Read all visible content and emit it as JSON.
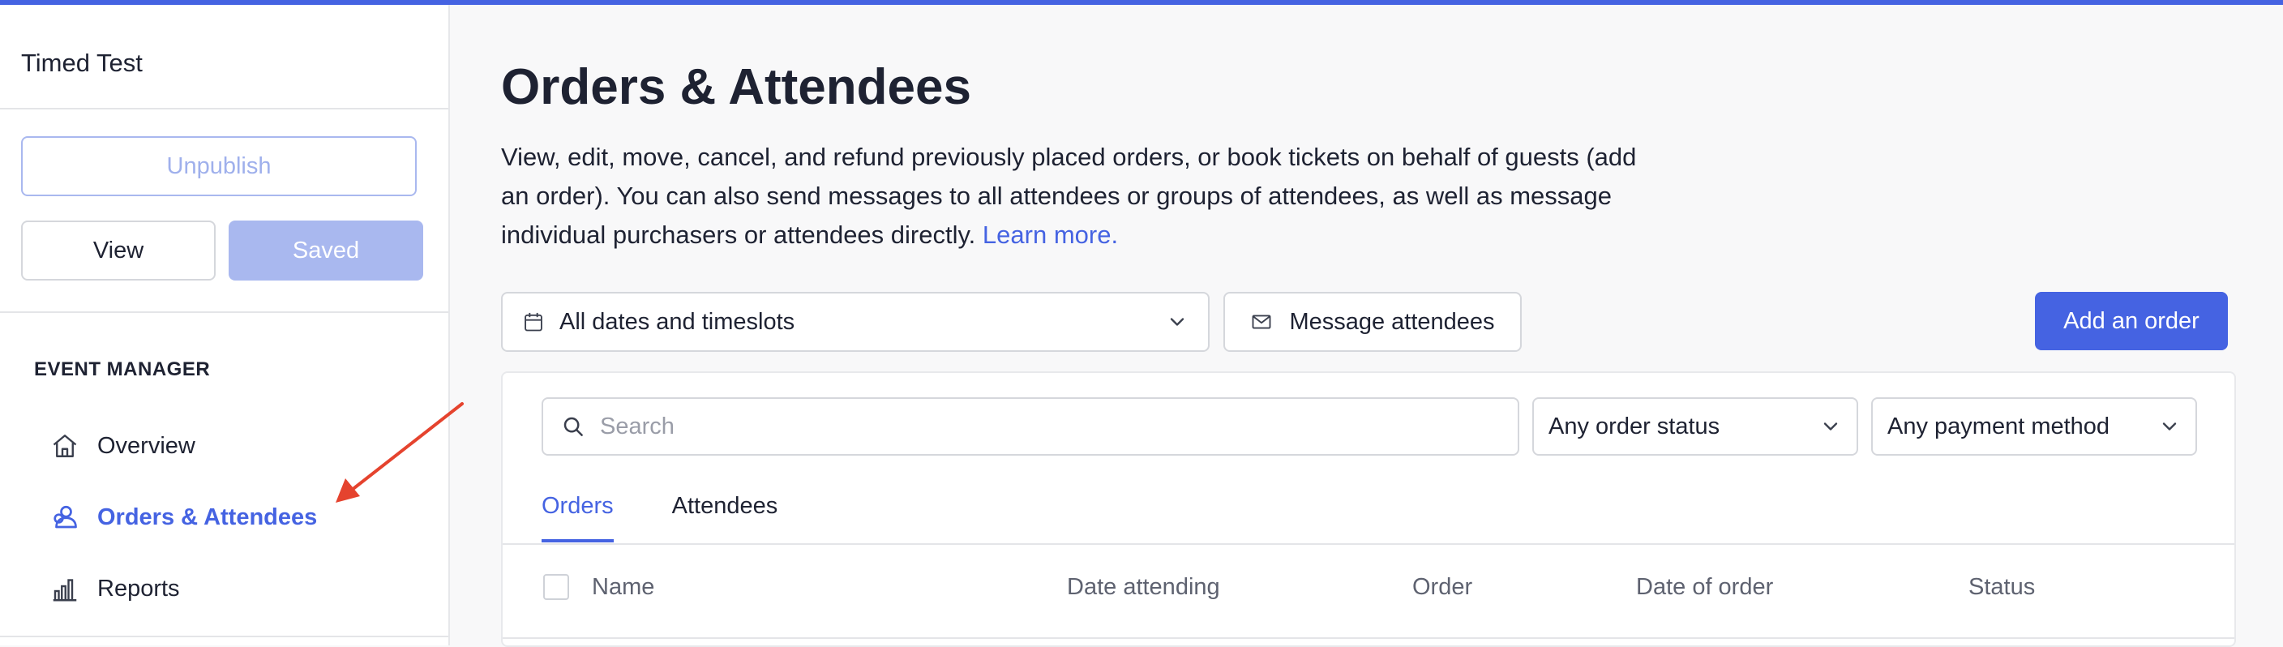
{
  "colors": {
    "accent": "#4563e2",
    "accent_light": "#a9b8ef",
    "arrow": "#e5432e",
    "text": "#1e2232",
    "muted": "#5e6270"
  },
  "sidebar": {
    "event_title": "Timed Test",
    "unpublish_label": "Unpublish",
    "view_label": "View",
    "saved_label": "Saved",
    "section_label": "EVENT MANAGER",
    "items": [
      {
        "label": "Overview",
        "icon": "home-icon"
      },
      {
        "label": "Orders & Attendees",
        "icon": "attendees-icon",
        "active": true
      },
      {
        "label": "Reports",
        "icon": "bar-chart-icon"
      }
    ]
  },
  "main": {
    "title": "Orders & Attendees",
    "description": "View, edit, move, cancel, and refund previously placed orders, or book tickets on behalf of guests (add an order). You can also send messages to all attendees or groups of attendees, as well as message individual purchasers or attendees directly.",
    "learn_more": "Learn more.",
    "date_filter": "All dates and timeslots",
    "message_label": "Message attendees",
    "add_order_label": "Add an order",
    "search_placeholder": "Search",
    "order_status_filter": "Any order status",
    "payment_method_filter": "Any payment method",
    "tabs": [
      {
        "label": "Orders",
        "active": true
      },
      {
        "label": "Attendees"
      }
    ],
    "columns": [
      "Name",
      "Date attending",
      "Order",
      "Date of order",
      "Status"
    ]
  }
}
